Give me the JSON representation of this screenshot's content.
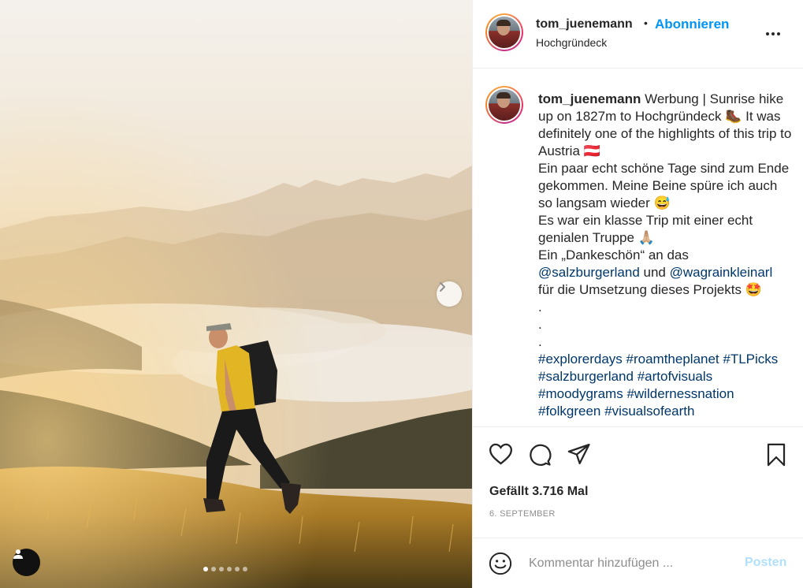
{
  "header": {
    "username": "tom_juenemann",
    "bullet": "•",
    "follow_label": "Abonnieren",
    "location": "Hochgründeck"
  },
  "caption": {
    "username": "tom_juenemann",
    "line1": " Werbung | Sunrise hike up on 1827m to Hochgründeck 🥾 It was definitely one of the highlights of this trip to Austria 🇦🇹",
    "line2": "Ein paar echt schöne Tage sind zum Ende gekommen. Meine Beine spüre ich auch so langsam wieder 😅",
    "line3": "Es war ein klasse Trip mit einer echt genialen Truppe 🙏🏼",
    "line4": "Ein „Dankeschön“ an das",
    "mention1": "@salzburgerland",
    "and": " und ",
    "mention2": "@wagrainkleinarl",
    "line5": "für die Umsetzung dieses Projekts 🤩",
    "dot": ".",
    "hashtags": [
      "#explorerdays",
      "#roamtheplanet",
      "#TLPicks",
      "#salzburgerland",
      "#artofvisuals",
      "#moodygrams",
      "#wildernessnation",
      "#folkgreen",
      "#visualsofearth"
    ]
  },
  "actions": {
    "likes": "Gefällt 3.716 Mal",
    "date": "6. SEPTEMBER"
  },
  "comment": {
    "placeholder": "Kommentar hinzufügen ...",
    "post_label": "Posten"
  },
  "carousel": {
    "slide_count": 6,
    "active_index": 0
  },
  "colors": {
    "accent": "#0095f6",
    "link": "#00376b",
    "post_disabled": "#b2dffc",
    "muted": "#8e8e8e"
  }
}
